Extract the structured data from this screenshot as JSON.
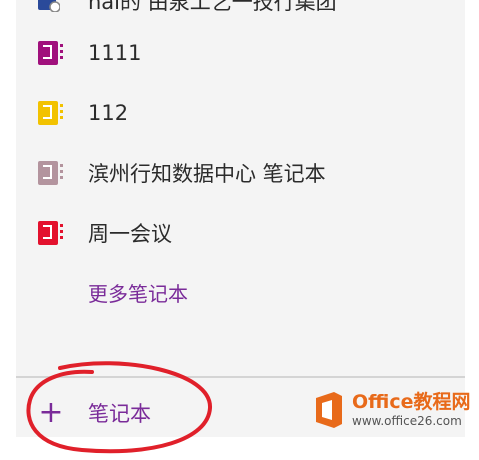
{
  "notebooks_list": {
    "partial_item": {
      "label": "hai的 由泉工艺一技行集团",
      "icon": "notebook-icon",
      "color": "#2a4a9a"
    },
    "items": [
      {
        "label": "1111",
        "icon": "notebook-icon",
        "color": "#a0107c"
      },
      {
        "label": "112",
        "icon": "notebook-icon",
        "color": "#f2c200"
      },
      {
        "label": "滨州行知数据中心 笔记本",
        "icon": "notebook-icon",
        "color": "#b3949e"
      },
      {
        "label": "周一会议",
        "icon": "notebook-icon",
        "color": "#e3112d"
      }
    ],
    "more_label": "更多笔记本"
  },
  "footer": {
    "add_icon": "plus-icon",
    "add_label": "笔记本"
  },
  "annotation": {
    "circle_color": "#e0202a"
  },
  "watermark": {
    "title": "Office教程网",
    "url": "www.office26.com",
    "brand_color": "#e86a1a"
  }
}
